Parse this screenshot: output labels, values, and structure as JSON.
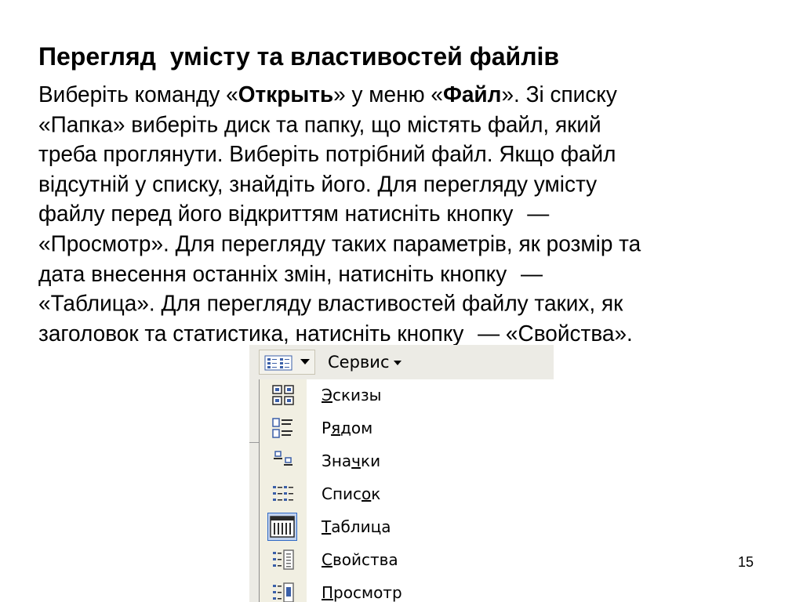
{
  "slide": {
    "title": "Перегляд  умісту та властивостей файлів",
    "page_number": "15",
    "body": [
      [
        {
          "t": "Виберіть команду «"
        },
        {
          "t": "Открыть",
          "b": true
        },
        {
          "t": "» у меню «"
        },
        {
          "t": "Файл",
          "b": true
        },
        {
          "t": "». Зі списку"
        }
      ],
      [
        {
          "t": "«Папка» виберіть диск та папку, що містять файл, який"
        }
      ],
      [
        {
          "t": "треба проглянути. Виберіть потрібний файл. Якщо файл"
        }
      ],
      [
        {
          "t": "відсутній у списку, знайдіть його. Для перегляду умісту"
        }
      ],
      [
        {
          "t": "файлу перед його відкриттям натисніть кнопку "
        },
        {
          "gap": true
        },
        {
          "t": "—"
        }
      ],
      [
        {
          "t": "«Просмотр». Для перегляду таких параметрів, як розмір та"
        }
      ],
      [
        {
          "t": "дата внесення останніх змін, натисніть кнопку "
        },
        {
          "gap": true
        },
        {
          "t": "—"
        }
      ],
      [
        {
          "t": "«Таблица». Для перегляду властивостей файлу таких, як"
        }
      ],
      [
        {
          "t": "заголовок та статистика, натисніть кнопку "
        },
        {
          "gap": true
        },
        {
          "t": "— «Свойства»."
        }
      ]
    ]
  },
  "screenshot": {
    "toolbar": {
      "views_icon": "views-grid-icon",
      "service_label": "Сервис"
    },
    "menu": [
      {
        "id": "eskizy",
        "icon": "thumbnails-view-icon",
        "pre": "",
        "hot": "Э",
        "post": "скизы",
        "checked": false
      },
      {
        "id": "ryadom",
        "icon": "tiles-view-icon",
        "pre": "Р",
        "hot": "я",
        "post": "дом",
        "checked": false
      },
      {
        "id": "znachki",
        "icon": "icons-view-icon",
        "pre": "Зна",
        "hot": "ч",
        "post": "ки",
        "checked": false
      },
      {
        "id": "spisok",
        "icon": "list-view-icon",
        "pre": "Спис",
        "hot": "о",
        "post": "к",
        "checked": false
      },
      {
        "id": "tablitsa",
        "icon": "details-view-icon",
        "pre": "",
        "hot": "Т",
        "post": "аблица",
        "checked": true
      },
      {
        "id": "svoystva",
        "icon": "properties-view-icon",
        "pre": "",
        "hot": "С",
        "post": "войства",
        "checked": false
      },
      {
        "id": "prosmotr",
        "icon": "preview-view-icon",
        "pre": "",
        "hot": "П",
        "post": "росмотр",
        "checked": false
      }
    ],
    "colors": {
      "toolbar_bg": "#ecebe5",
      "icon_gutter": "#f1efe2",
      "checked_bg": "#c1d2ee",
      "checked_border": "#316ac5"
    }
  }
}
